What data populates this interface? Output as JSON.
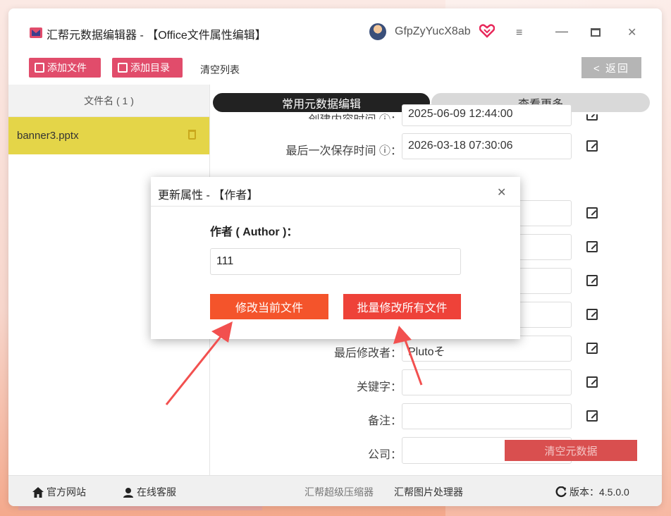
{
  "window": {
    "title": "汇帮元数据编辑器 - 【Office文件属性编辑】",
    "username": "GfpZyYucX8ab",
    "menu_glyph": "≡",
    "minimize_glyph": "—",
    "close_glyph": "✕"
  },
  "toolbar": {
    "add_file_label": "添加文件",
    "add_dir_label": "添加目录",
    "clear_list_label": "清空列表",
    "back_label": "< 返回"
  },
  "sidebar": {
    "header": "文件名 ( 1 )",
    "files": [
      {
        "name": "banner3.pptx"
      }
    ]
  },
  "tabs": {
    "common": "常用元数据编辑",
    "more": "查看更多"
  },
  "fields": {
    "created_label": "创建内容时间 ⓘ：",
    "created_value": "2025-06-09 12:44:00",
    "saved_label": "最后一次保存时间 ⓘ：",
    "saved_value": "2026-03-18 07:30:06",
    "last_modifier_label": "最后修改者：",
    "last_modifier_value": "Plutoそ",
    "keywords_label": "关键字：",
    "keywords_value": "",
    "notes_label": "备注：",
    "notes_value": "",
    "company_label": "公司：",
    "company_value": ""
  },
  "clear_meta_label": "清空元数据",
  "footer": {
    "website": "官方网站",
    "support": "在线客服",
    "compressor": "汇帮超级压缩器",
    "image_processor": "汇帮图片处理器",
    "version": "版本：4.5.0.0"
  },
  "dialog": {
    "title": "更新属性 - 【作者】",
    "close_glyph": "✕",
    "field_label": "作者 ( Author )：",
    "field_value": "111",
    "btn_current": "修改当前文件",
    "btn_batch": "批量修改所有文件"
  },
  "colors": {
    "accent_pink": "#e14c6b",
    "selected_row": "#e4d548",
    "dialog_button": "#f4542b",
    "arrow_red": "#f2504f"
  },
  "icons": [
    "app-logo-icon",
    "vip-heart-icon",
    "menu-icon",
    "trash-icon",
    "edit-icon",
    "home-icon",
    "support-icon",
    "refresh-icon"
  ]
}
